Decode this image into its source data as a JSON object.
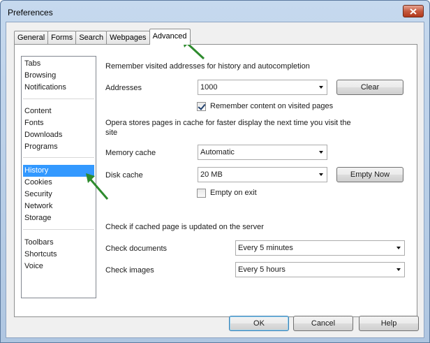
{
  "window": {
    "title": "Preferences"
  },
  "tabs": [
    {
      "label": "General"
    },
    {
      "label": "Forms"
    },
    {
      "label": "Search"
    },
    {
      "label": "Webpages"
    },
    {
      "label": "Advanced"
    }
  ],
  "categories": [
    {
      "label": "Tabs"
    },
    {
      "label": "Browsing"
    },
    {
      "label": "Notifications"
    },
    {
      "label": "Content"
    },
    {
      "label": "Fonts"
    },
    {
      "label": "Downloads"
    },
    {
      "label": "Programs"
    },
    {
      "label": "History"
    },
    {
      "label": "Cookies"
    },
    {
      "label": "Security"
    },
    {
      "label": "Network"
    },
    {
      "label": "Storage"
    },
    {
      "label": "Toolbars"
    },
    {
      "label": "Shortcuts"
    },
    {
      "label": "Voice"
    }
  ],
  "history": {
    "remember_heading": "Remember visited addresses for history and autocompletion",
    "addresses_label": "Addresses",
    "addresses_value": "1000",
    "clear_label": "Clear",
    "remember_content_label": "Remember content on visited pages",
    "remember_content_checked": true,
    "cache_note": "Opera stores pages in cache for faster display the next time you visit the site",
    "memory_cache_label": "Memory cache",
    "memory_cache_value": "Automatic",
    "disk_cache_label": "Disk cache",
    "disk_cache_value": "20 MB",
    "empty_now_label": "Empty Now",
    "empty_on_exit_label": "Empty on exit",
    "empty_on_exit_checked": false,
    "check_heading": "Check if cached page is updated on the server",
    "check_documents_label": "Check documents",
    "check_documents_value": "Every 5 minutes",
    "check_images_label": "Check images",
    "check_images_value": "Every 5 hours"
  },
  "buttons": {
    "ok": "OK",
    "cancel": "Cancel",
    "help": "Help"
  },
  "colors": {
    "selection": "#3399ff",
    "annotation_arrow": "#2e8b2e"
  }
}
